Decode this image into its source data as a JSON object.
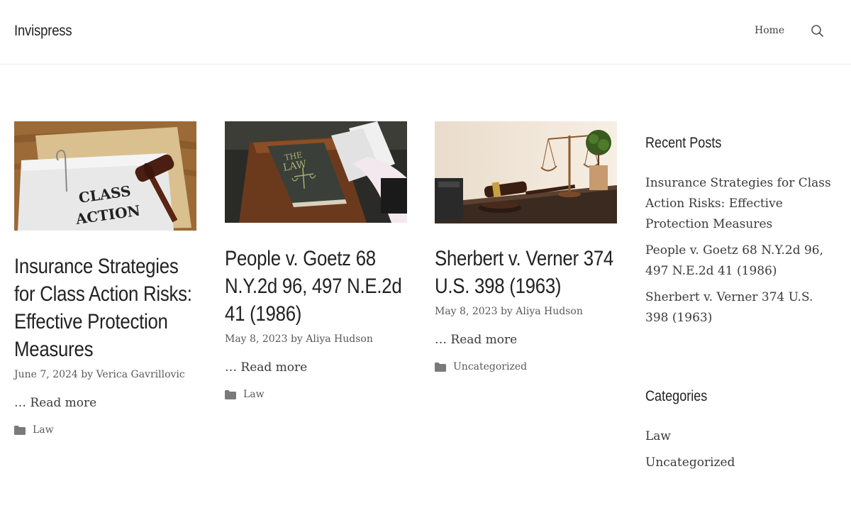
{
  "site": {
    "title": "Invispress"
  },
  "nav": {
    "home": "Home",
    "search_icon": "search-icon"
  },
  "posts": [
    {
      "title": "Insurance Strategies for Class Action Risks: Effective Protection Measures",
      "date": "June 7, 2024",
      "by": "by",
      "author": "Verica Gavrillovic",
      "read_more": "… Read more",
      "category": "Law",
      "image_text": [
        "CLASS",
        "ACTION"
      ]
    },
    {
      "title": "People v. Goetz 68 N.Y.2d 96, 497 N.E.2d 41 (1986)",
      "date": "May 8, 2023",
      "by": "by",
      "author": "Aliya Hudson",
      "read_more": "… Read more",
      "category": "Law",
      "image_text": [
        "THE",
        "LAW"
      ]
    },
    {
      "title": "Sherbert v. Verner 374 U.S. 398 (1963)",
      "date": "May 8, 2023",
      "by": "by",
      "author": "Aliya Hudson",
      "read_more": "… Read more",
      "category": "Uncategorized"
    }
  ],
  "sidebar": {
    "recent_title": "Recent Posts",
    "recent": [
      "Insurance Strategies for Class Action Risks: Effective Protection Measures",
      "People v. Goetz 68 N.Y.2d 96, 497 N.E.2d 41 (1986)",
      "Sherbert v. Verner 374 U.S. 398 (1963)"
    ],
    "categories_title": "Categories",
    "categories": [
      "Law",
      "Uncategorized"
    ]
  }
}
